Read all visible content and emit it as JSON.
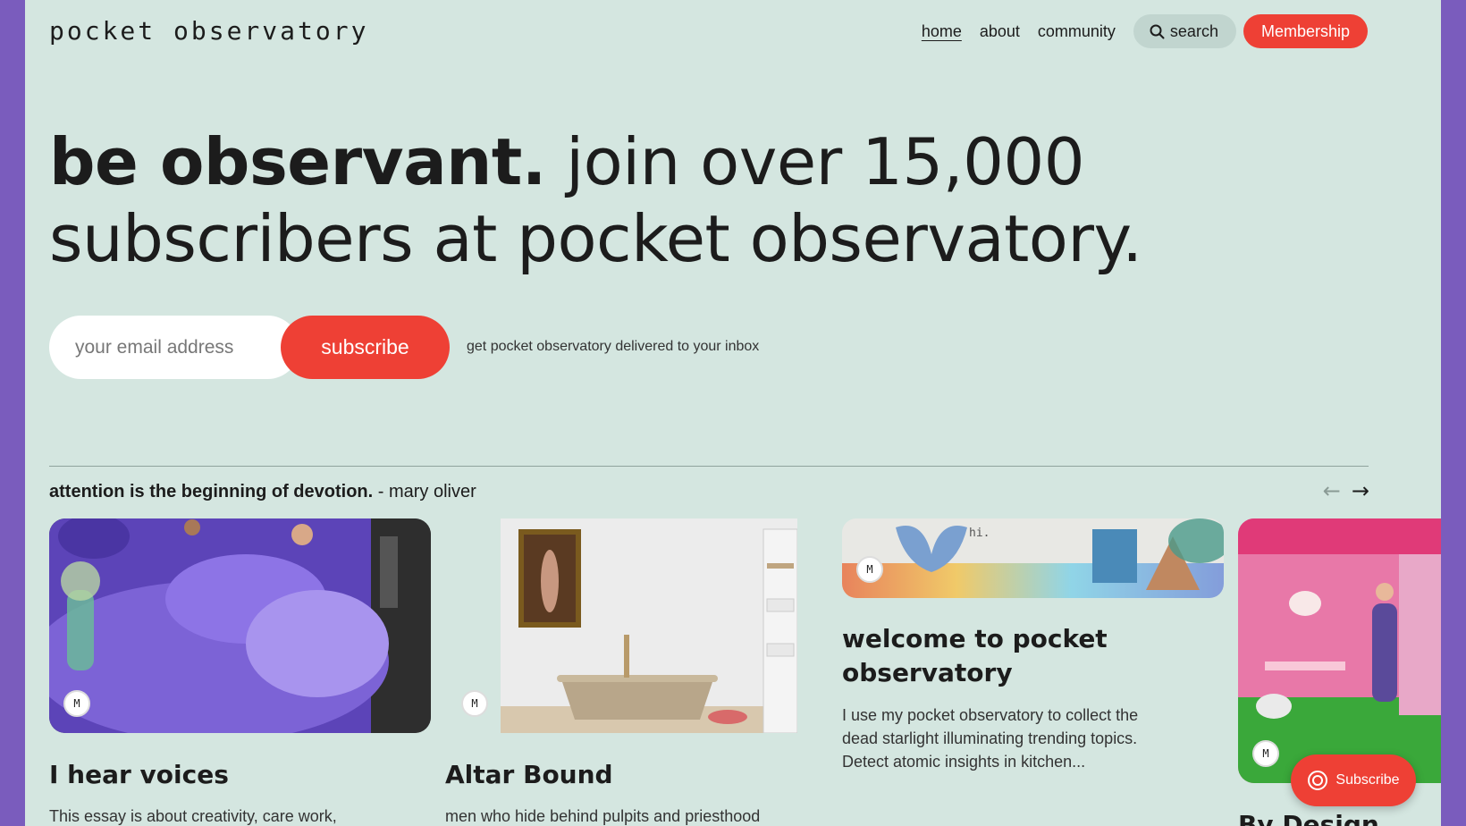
{
  "header": {
    "logo": "pocket observatory",
    "nav": [
      "home",
      "about",
      "community"
    ],
    "search_label": "search",
    "membership_label": "Membership"
  },
  "hero": {
    "bold": "be observant.",
    "rest": " join over 15,000 subscribers at pocket observatory."
  },
  "subscribe": {
    "placeholder": "your email address",
    "button_label": "subscribe",
    "note": "get pocket observatory delivered to your inbox"
  },
  "quote": {
    "text": "attention is the beginning of devotion.",
    "author": " - mary oliver"
  },
  "cards": [
    {
      "avatar": "M",
      "title": "I hear voices",
      "excerpt": "This essay is about creativity, care work,"
    },
    {
      "avatar": "M",
      "title": "Altar Bound",
      "excerpt": "men who hide behind pulpits and priesthood"
    },
    {
      "avatar": "M",
      "title": "welcome to pocket observatory",
      "excerpt": "I use my pocket observatory to collect the dead starlight illuminating trending topics. Detect atomic insights in kitchen...",
      "image_text": "hi."
    },
    {
      "avatar": "M",
      "title": "By Design"
    }
  ],
  "floating_subscribe": {
    "label": "Subscribe"
  },
  "colors": {
    "accent": "#ee4035",
    "background": "#d4e6e0",
    "frame": "#7a5cbd"
  }
}
